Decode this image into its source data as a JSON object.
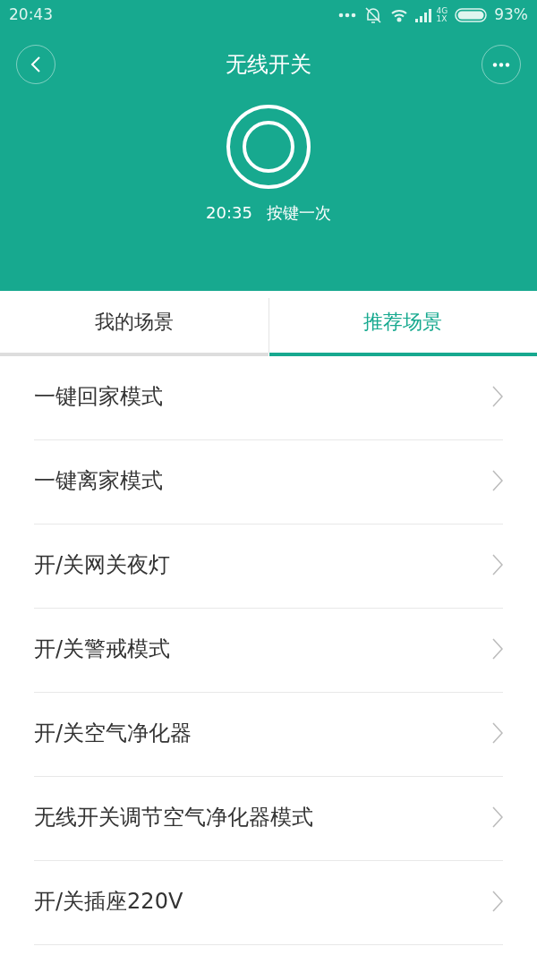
{
  "status_bar": {
    "time": "20:43",
    "network_top": "4G",
    "network_bottom": "1X",
    "battery": "93%"
  },
  "header": {
    "title": "无线开关"
  },
  "last_event": {
    "time": "20:35",
    "action": "按键一次"
  },
  "tabs": [
    {
      "label": "我的场景",
      "selected": false
    },
    {
      "label": "推荐场景",
      "selected": true
    }
  ],
  "scenes": [
    {
      "label": "一键回家模式"
    },
    {
      "label": "一键离家模式"
    },
    {
      "label": "开/关网关夜灯"
    },
    {
      "label": "开/关警戒模式"
    },
    {
      "label": "开/关空气净化器"
    },
    {
      "label": "无线开关调节空气净化器模式"
    },
    {
      "label": "开/关插座220V"
    }
  ]
}
